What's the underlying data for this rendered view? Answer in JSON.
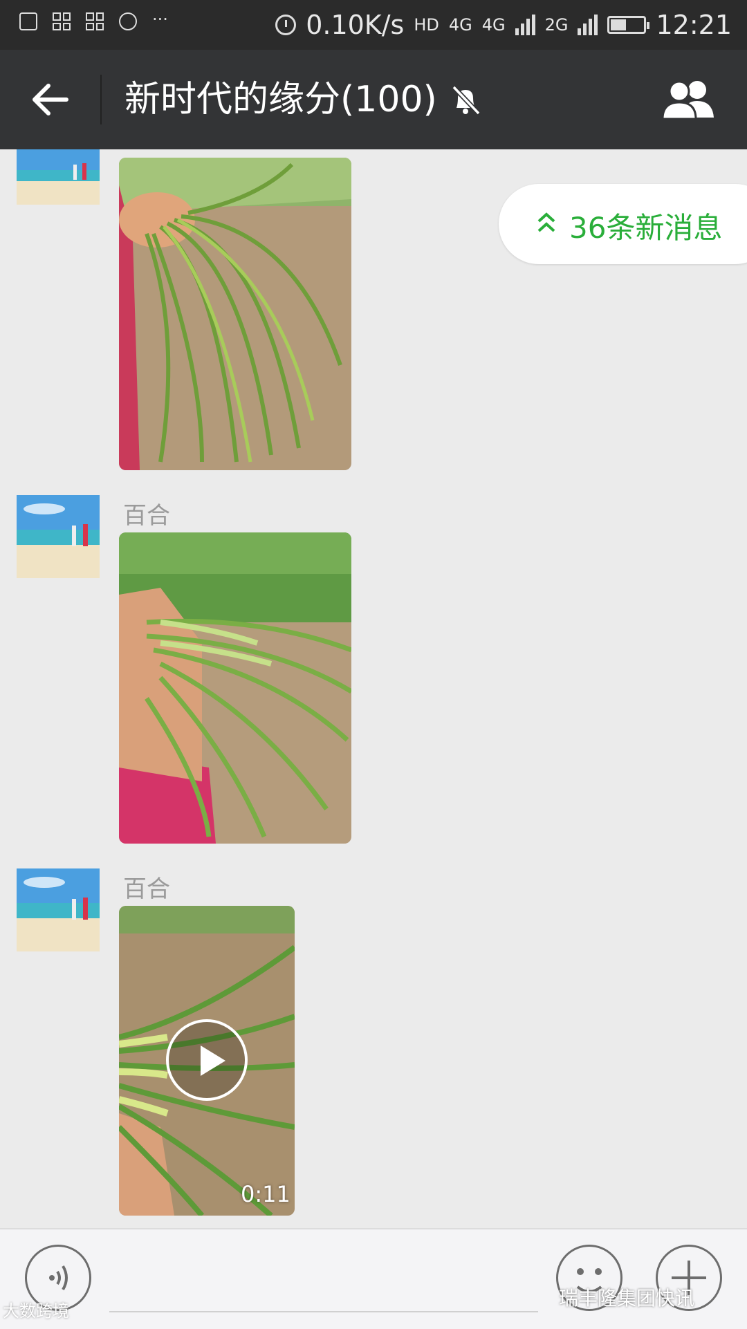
{
  "status_bar": {
    "net_speed": "0.10K/s",
    "hd": "HD",
    "net1": "4G",
    "net2": "4G",
    "net3": "2G",
    "time": "12:21",
    "dots": "···",
    "icons": [
      "image-icon",
      "app-icon",
      "app-icon",
      "location-icon",
      "alarm-icon",
      "signal-icon",
      "signal-icon",
      "battery-icon"
    ]
  },
  "nav": {
    "title": "新时代的缘分(100)",
    "icons": [
      "back-arrow-icon",
      "mute-bell-icon",
      "group-members-icon"
    ]
  },
  "chat": {
    "new_messages": "36条新消息",
    "messages": [
      {
        "sender": "",
        "type": "image"
      },
      {
        "sender": "百合",
        "type": "image"
      },
      {
        "sender": "百合",
        "type": "video",
        "duration": "0:11"
      }
    ]
  },
  "input_bar": {
    "icons": [
      "voice-icon",
      "emoji-icon",
      "plus-icon"
    ]
  },
  "watermarks": {
    "left": "大数跨境",
    "right": "瑞丰隆集团快讯"
  }
}
